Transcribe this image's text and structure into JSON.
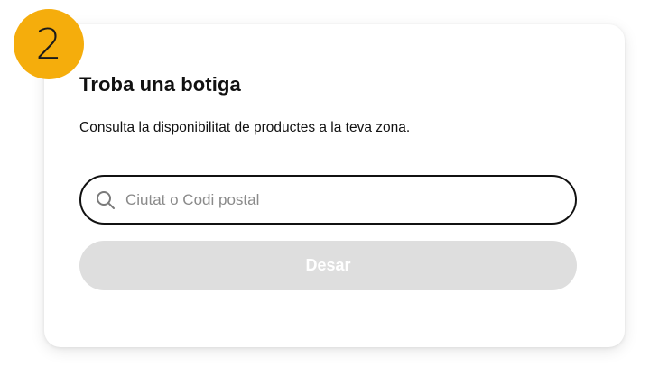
{
  "step": {
    "number": "2"
  },
  "card": {
    "title": "Troba una botiga",
    "description": "Consulta la disponibilitat de productes a la teva zona."
  },
  "search": {
    "icon": "search-icon",
    "value": "",
    "placeholder": "Ciutat o Codi postal"
  },
  "submit": {
    "label": "Desar",
    "state": "disabled"
  },
  "colors": {
    "badge": "#f5ad0c",
    "text": "#111111",
    "button_disabled_bg": "#dedede",
    "button_disabled_text": "#ffffff",
    "placeholder": "#8a8a8a"
  }
}
